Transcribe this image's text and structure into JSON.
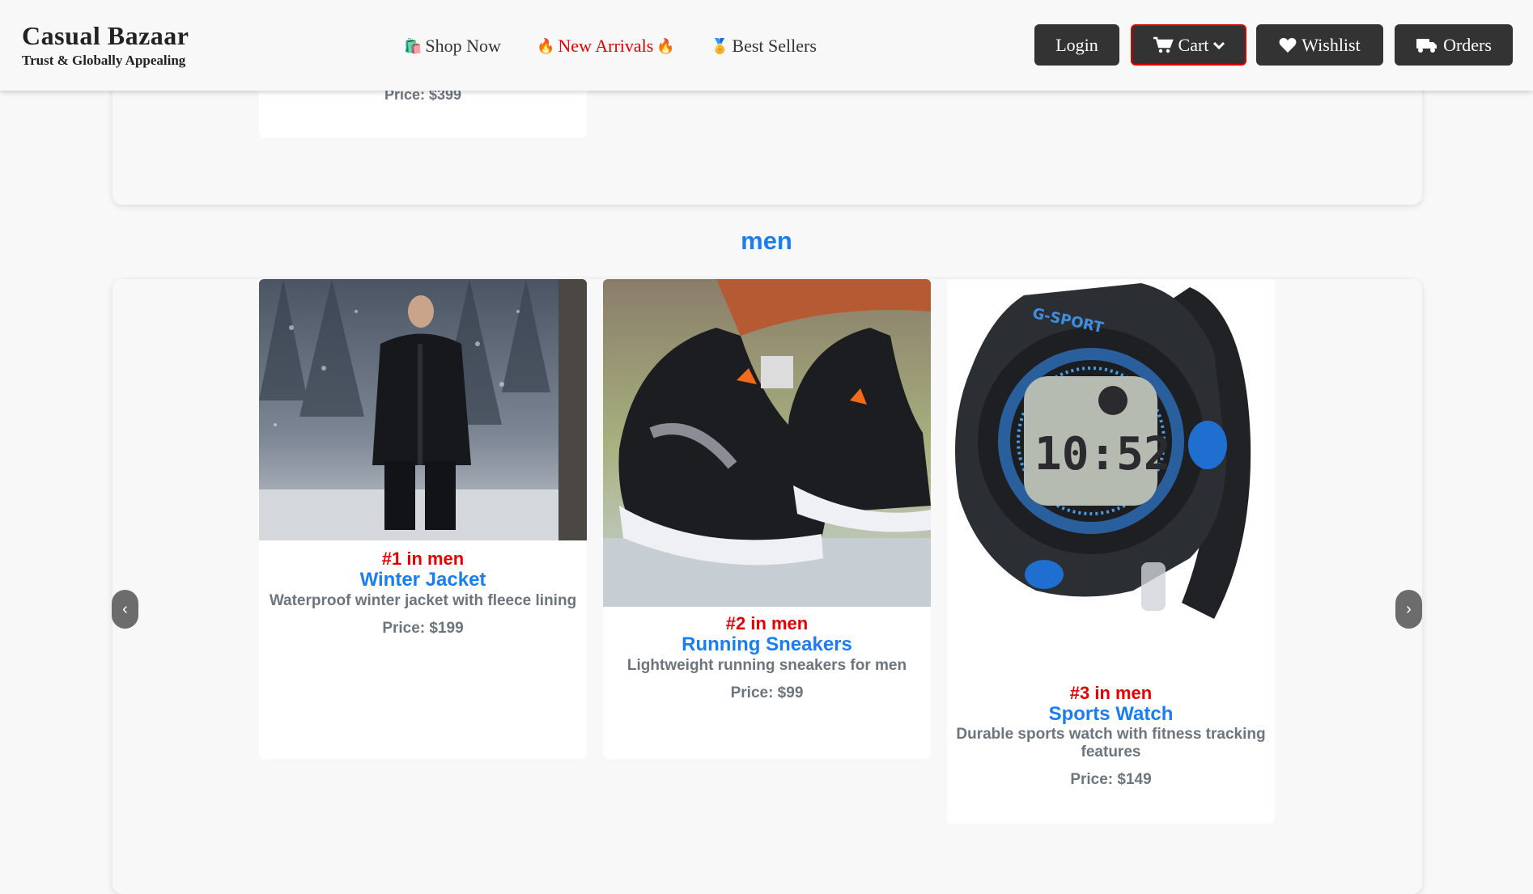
{
  "header": {
    "brand_name": "Casual Bazaar",
    "brand_tagline": "Trust & Globally Appealing",
    "nav": [
      {
        "icon": "🛍️",
        "label": "Shop Now"
      },
      {
        "icon": "🔥",
        "label": "New Arrivals",
        "icon_after": "🔥"
      },
      {
        "icon": "🏅",
        "label": "Best Sellers"
      }
    ],
    "buttons": {
      "login": "Login",
      "cart": "Cart",
      "wishlist": "Wishlist",
      "orders": "Orders"
    }
  },
  "top_section": {
    "price": "Price: $399"
  },
  "category": {
    "title": "men",
    "products": [
      {
        "rank": "#1 in men",
        "name": "Winter Jacket",
        "description": "Waterproof winter jacket with fleece lining",
        "price": "Price: $199"
      },
      {
        "rank": "#2 in men",
        "name": "Running Sneakers",
        "description": "Lightweight running sneakers for men",
        "price": "Price: $99"
      },
      {
        "rank": "#3 in men",
        "name": "Sports Watch",
        "description": "Durable sports watch with fitness tracking features",
        "price": "Price: $149"
      }
    ],
    "prev_arrow": "‹",
    "next_arrow": "›"
  },
  "colors": {
    "accent_blue": "#1a7ef2",
    "rank_red": "#e60000",
    "button_dark": "#333333",
    "muted_text": "#6c757d"
  }
}
